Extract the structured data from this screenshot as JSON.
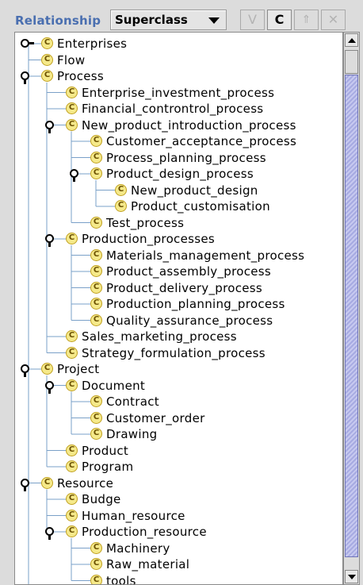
{
  "toolbar": {
    "relationship_label": "Relationship",
    "relationship_value": "Superclass",
    "buttons": {
      "v": "V",
      "c": "C",
      "up": "⇑",
      "delete": "✕"
    }
  },
  "tree": {
    "icon_glyph": "C",
    "nodes": [
      {
        "label": "Enterprises",
        "depth": 0,
        "handle": "collapsed"
      },
      {
        "label": "Flow",
        "depth": 0,
        "handle": "none"
      },
      {
        "label": "Process",
        "depth": 0,
        "handle": "expanded"
      },
      {
        "label": "Enterprise_investment_process",
        "depth": 1,
        "handle": "none"
      },
      {
        "label": "Financial_controntrol_process",
        "depth": 1,
        "handle": "none"
      },
      {
        "label": "New_product_introduction_process",
        "depth": 1,
        "handle": "expanded"
      },
      {
        "label": "Customer_acceptance_process",
        "depth": 2,
        "handle": "none"
      },
      {
        "label": "Process_planning_process",
        "depth": 2,
        "handle": "none"
      },
      {
        "label": "Product_design_process",
        "depth": 2,
        "handle": "expanded"
      },
      {
        "label": "New_product_design",
        "depth": 3,
        "handle": "none"
      },
      {
        "label": "Product_customisation",
        "depth": 3,
        "handle": "none"
      },
      {
        "label": "Test_process",
        "depth": 2,
        "handle": "none"
      },
      {
        "label": "Production_processes",
        "depth": 1,
        "handle": "expanded"
      },
      {
        "label": "Materials_management_process",
        "depth": 2,
        "handle": "none"
      },
      {
        "label": "Product_assembly_process",
        "depth": 2,
        "handle": "none"
      },
      {
        "label": "Product_delivery_process",
        "depth": 2,
        "handle": "none"
      },
      {
        "label": "Production_planning_process",
        "depth": 2,
        "handle": "none"
      },
      {
        "label": "Quality_assurance_process",
        "depth": 2,
        "handle": "none"
      },
      {
        "label": "Sales_marketing_process",
        "depth": 1,
        "handle": "none"
      },
      {
        "label": "Strategy_formulation_process",
        "depth": 1,
        "handle": "none"
      },
      {
        "label": "Project",
        "depth": 0,
        "handle": "expanded"
      },
      {
        "label": "Document",
        "depth": 1,
        "handle": "expanded"
      },
      {
        "label": "Contract",
        "depth": 2,
        "handle": "none"
      },
      {
        "label": "Customer_order",
        "depth": 2,
        "handle": "none"
      },
      {
        "label": "Drawing",
        "depth": 2,
        "handle": "none"
      },
      {
        "label": "Product",
        "depth": 1,
        "handle": "none"
      },
      {
        "label": "Program",
        "depth": 1,
        "handle": "none"
      },
      {
        "label": "Resource",
        "depth": 0,
        "handle": "expanded"
      },
      {
        "label": "Budge",
        "depth": 1,
        "handle": "none"
      },
      {
        "label": "Human_resource",
        "depth": 1,
        "handle": "none"
      },
      {
        "label": "Production_resource",
        "depth": 1,
        "handle": "expanded"
      },
      {
        "label": "Machinery",
        "depth": 2,
        "handle": "none"
      },
      {
        "label": "Raw_material",
        "depth": 2,
        "handle": "none"
      },
      {
        "label": "tools",
        "depth": 2,
        "handle": "none"
      }
    ]
  },
  "colors": {
    "relationship_label": "#4a6fb0",
    "class_icon_fill": "#f5e98a",
    "scroll_thumb": "#a7abe2"
  }
}
